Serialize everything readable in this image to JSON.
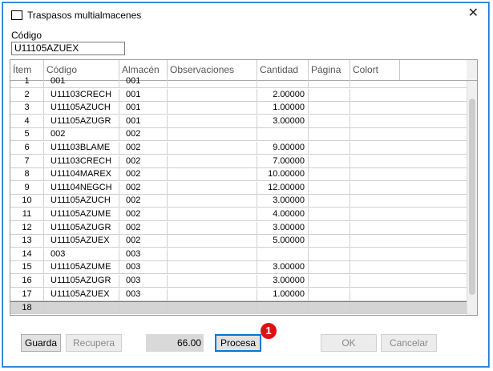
{
  "window": {
    "title": "Traspasos multialmacenes",
    "close_glyph": "✕"
  },
  "codigo": {
    "label": "Código",
    "value": "U11105AZUEX"
  },
  "grid": {
    "columns": [
      "Ítem",
      "Código",
      "Almacén",
      "Observaciones",
      "Cantidad",
      "Página",
      "Colort"
    ],
    "rows": [
      [
        "1",
        "001",
        "001",
        "",
        "",
        "",
        ""
      ],
      [
        "2",
        "U11103CRECH",
        "001",
        "",
        "2.00000",
        "",
        ""
      ],
      [
        "3",
        "U11105AZUCH",
        "001",
        "",
        "1.00000",
        "",
        ""
      ],
      [
        "4",
        "U11105AZUGR",
        "001",
        "",
        "3.00000",
        "",
        ""
      ],
      [
        "5",
        "002",
        "002",
        "",
        "",
        "",
        ""
      ],
      [
        "6",
        "U11103BLAME",
        "002",
        "",
        "9.00000",
        "",
        ""
      ],
      [
        "7",
        "U11103CRECH",
        "002",
        "",
        "7.00000",
        "",
        ""
      ],
      [
        "8",
        "U11104MAREX",
        "002",
        "",
        "10.00000",
        "",
        ""
      ],
      [
        "9",
        "U11104NEGCH",
        "002",
        "",
        "12.00000",
        "",
        ""
      ],
      [
        "10",
        "U11105AZUCH",
        "002",
        "",
        "3.00000",
        "",
        ""
      ],
      [
        "11",
        "U11105AZUME",
        "002",
        "",
        "4.00000",
        "",
        ""
      ],
      [
        "12",
        "U11105AZUGR",
        "002",
        "",
        "3.00000",
        "",
        ""
      ],
      [
        "13",
        "U11105AZUEX",
        "002",
        "",
        "5.00000",
        "",
        ""
      ],
      [
        "14",
        "003",
        "003",
        "",
        "",
        "",
        ""
      ],
      [
        "15",
        "U11105AZUME",
        "003",
        "",
        "3.00000",
        "",
        ""
      ],
      [
        "16",
        "U11105AZUGR",
        "003",
        "",
        "3.00000",
        "",
        ""
      ],
      [
        "17",
        "U11105AZUEX",
        "003",
        "",
        "1.00000",
        "",
        ""
      ],
      [
        "18",
        "",
        "",
        "",
        "",
        "",
        ""
      ]
    ]
  },
  "footer": {
    "guarda": "Guarda",
    "recupera": "Recupera",
    "total": "66.00",
    "procesa": "Procesa",
    "ok": "OK",
    "cancelar": "Cancelar",
    "marker": "1"
  },
  "colors": {
    "accent": "#0078d7",
    "marker": "#e01010",
    "new_row": "#d4d4d4"
  }
}
